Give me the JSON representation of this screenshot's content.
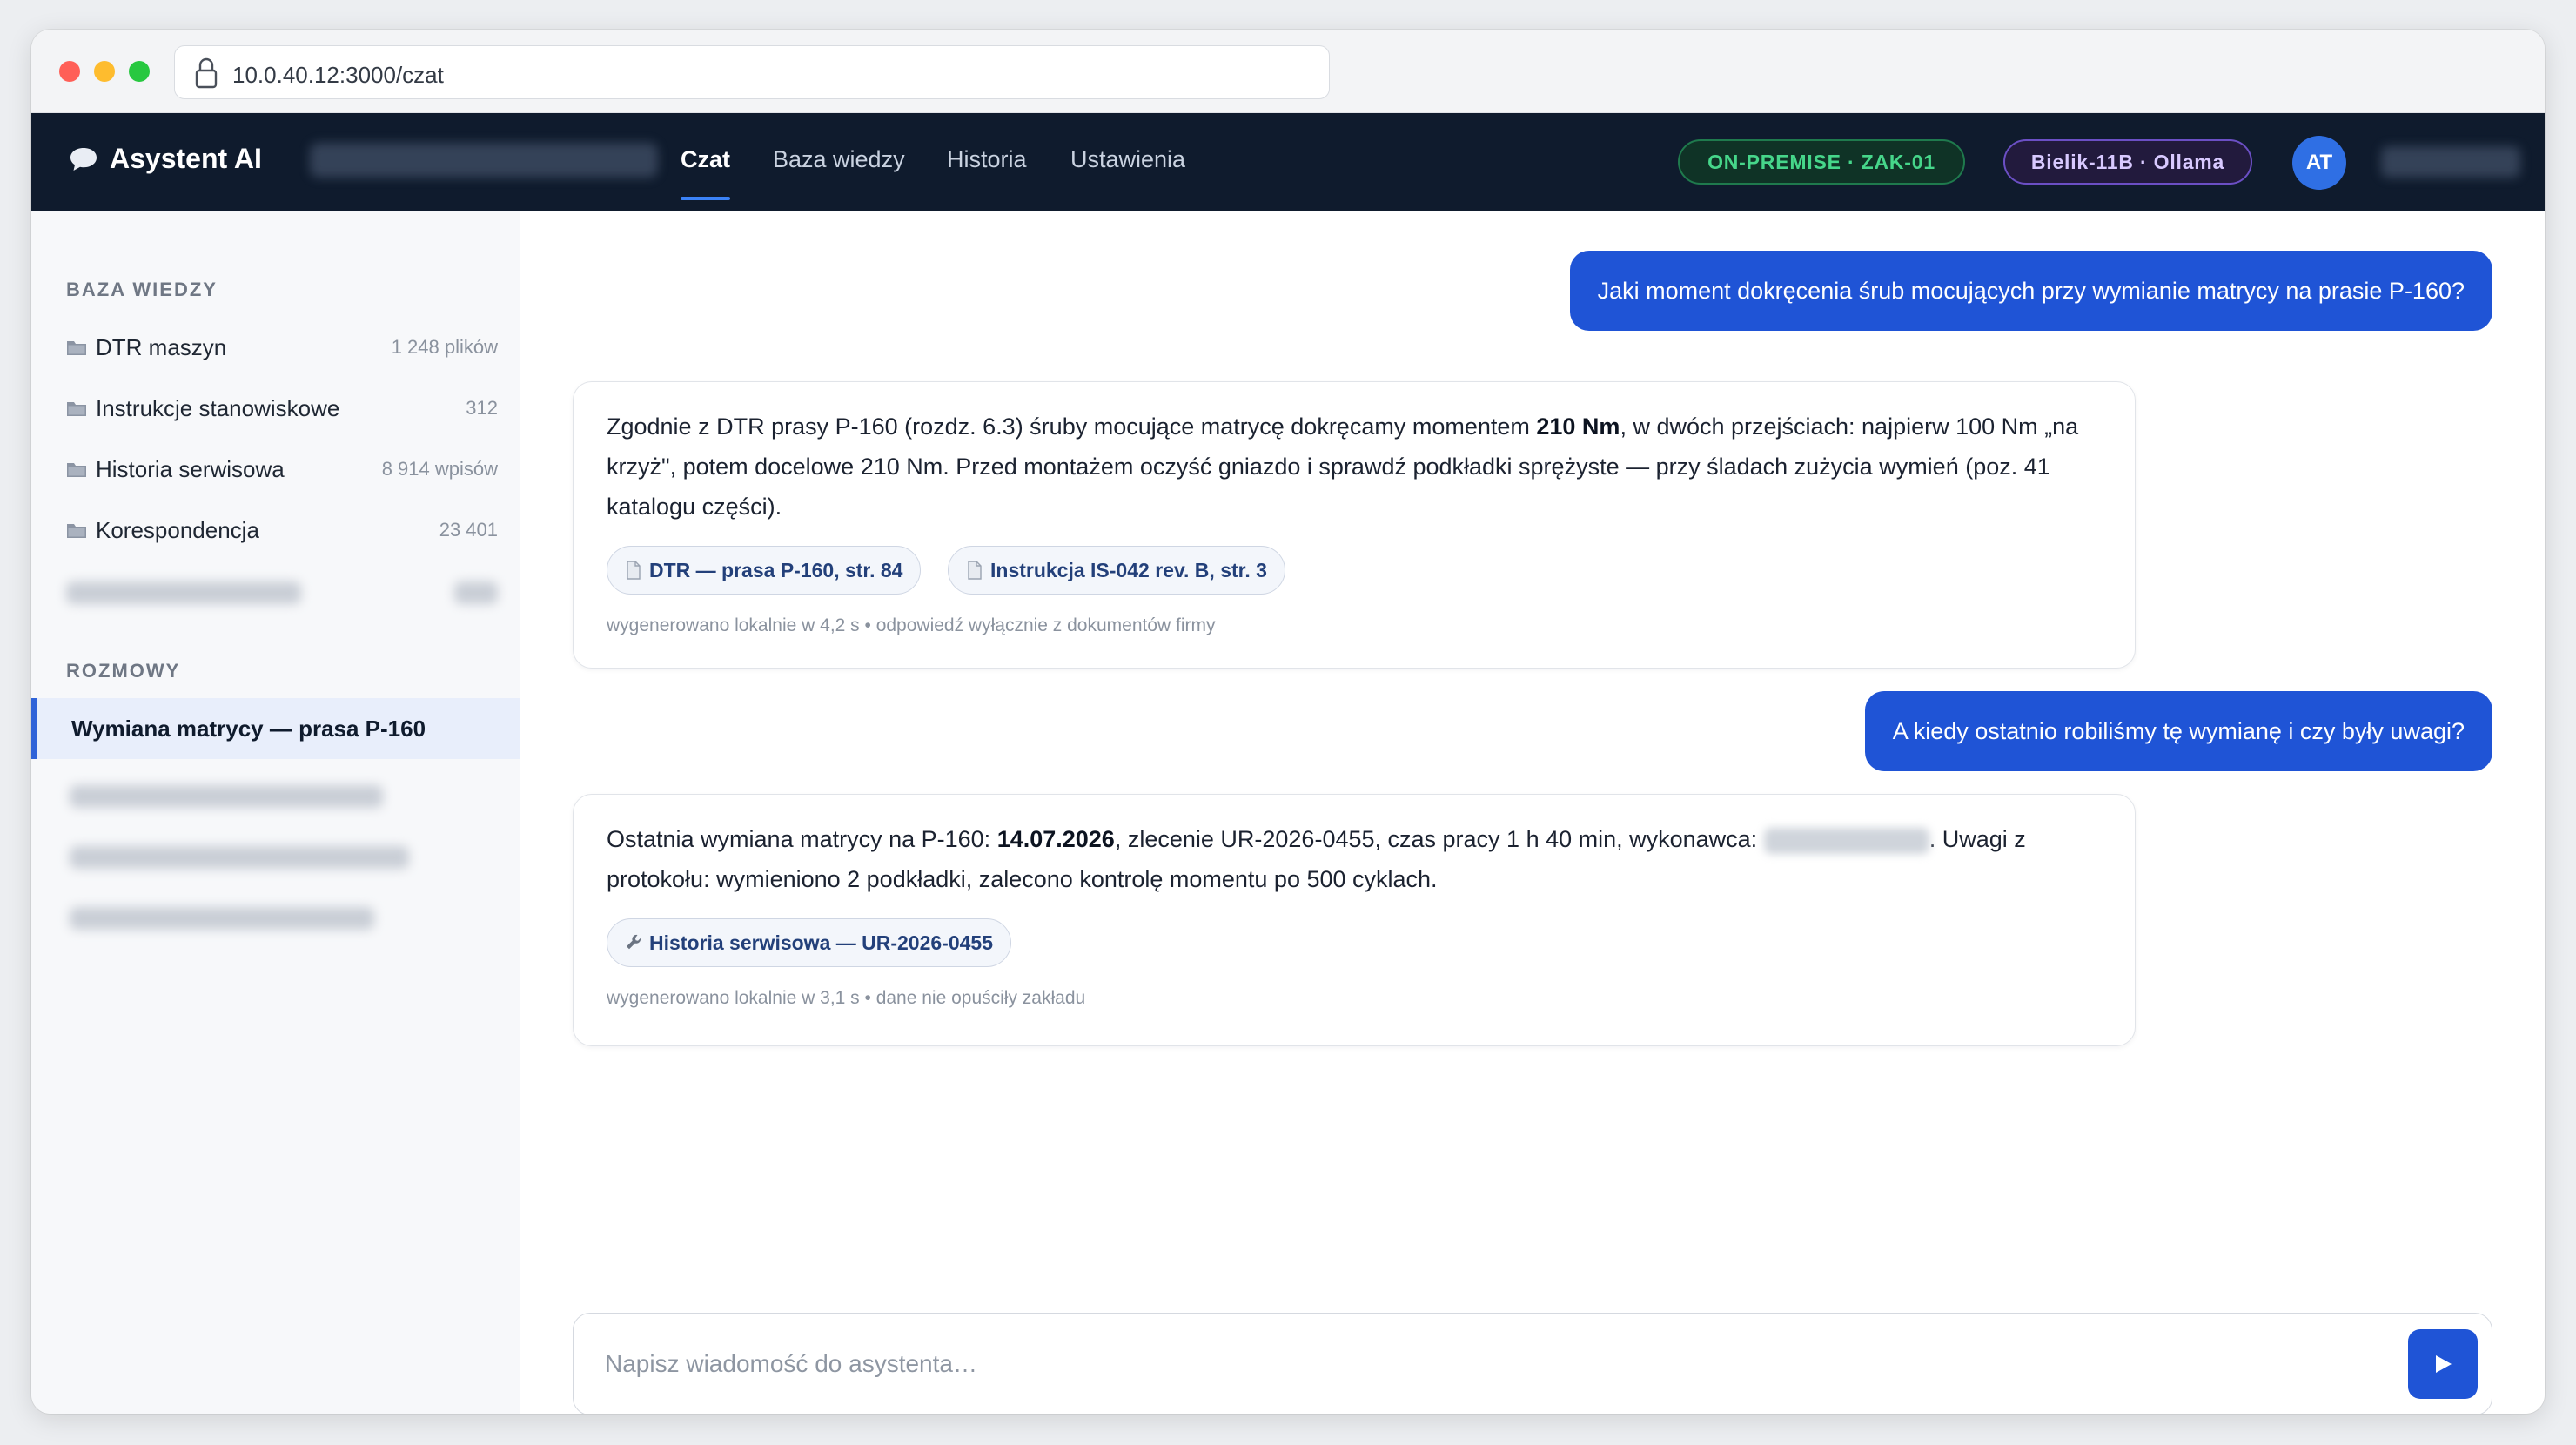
{
  "browser": {
    "url": "10.0.40.12:3000/czat"
  },
  "nav": {
    "brand": "Asystent AI",
    "tabs": [
      "Czat",
      "Baza wiedzy",
      "Historia",
      "Ustawienia"
    ],
    "active_tab": "Czat",
    "env_badge": "ON-PREMISE · ZAK-01",
    "model_badge": "Bielik-11B · Ollama",
    "avatar_initials": "AT"
  },
  "sidebar": {
    "kb_title": "BAZA WIEDZY",
    "kb_items": [
      {
        "label": "DTR maszyn",
        "count": "1 248 plików"
      },
      {
        "label": "Instrukcje stanowiskowe",
        "count": "312"
      },
      {
        "label": "Historia serwisowa",
        "count": "8 914 wpisów"
      },
      {
        "label": "Korespondencja",
        "count": "23 401"
      }
    ],
    "conv_title": "ROZMOWY",
    "conversations": [
      {
        "label": "Wymiana matrycy — prasa P-160",
        "active": true
      }
    ]
  },
  "chat": {
    "messages": [
      {
        "role": "user",
        "text": "Jaki moment dokręcenia śrub mocujących przy wymianie matrycy na prasie P-160?"
      },
      {
        "role": "assistant",
        "parts": [
          "Zgodnie z DTR prasy P-160 (rozdz. 6.3) śruby mocujące matrycę dokręcamy momentem ",
          "210 Nm",
          ", w dwóch przejściach: najpierw 100 Nm „na krzyż\", potem docelowe 210 Nm. Przed montażem oczyść gniazdo i sprawdź podkładki sprężyste — przy śladach zużycia wymień (poz. 41 katalogu części)."
        ],
        "sources": [
          {
            "icon": "document-icon",
            "label": "DTR — prasa P-160, str. 84"
          },
          {
            "icon": "document-icon",
            "label": "Instrukcja IS-042 rev. B, str. 3"
          }
        ],
        "meta": "wygenerowano lokalnie w 4,2 s • odpowiedź wyłącznie z dokumentów firmy"
      },
      {
        "role": "user",
        "text": "A kiedy ostatnio robiliśmy tę wymianę i czy były uwagi?"
      },
      {
        "role": "assistant",
        "parts": [
          "Ostatnia wymiana matrycy na P-160: ",
          "14.07.2026",
          ", zlecenie UR-2026-0455, czas pracy 1 h 40 min, wykonawca: ",
          ". Uwagi z protokołu: wymieniono 2 podkładki, zalecono kontrolę momentu po 500 cyklach."
        ],
        "sources": [
          {
            "icon": "wrench-icon",
            "label": "Historia serwisowa — UR-2026-0455"
          }
        ],
        "meta": "wygenerowano lokalnie w 3,1 s • dane nie opuściły zakładu"
      }
    ]
  },
  "composer": {
    "placeholder": "Napisz wiadomość do asystenta…",
    "value": ""
  },
  "colors": {
    "nav_bg": "#0f1b2d",
    "accent": "#1f54d6",
    "env_green": "#46d68a",
    "model_purple": "#d8c9ff"
  }
}
